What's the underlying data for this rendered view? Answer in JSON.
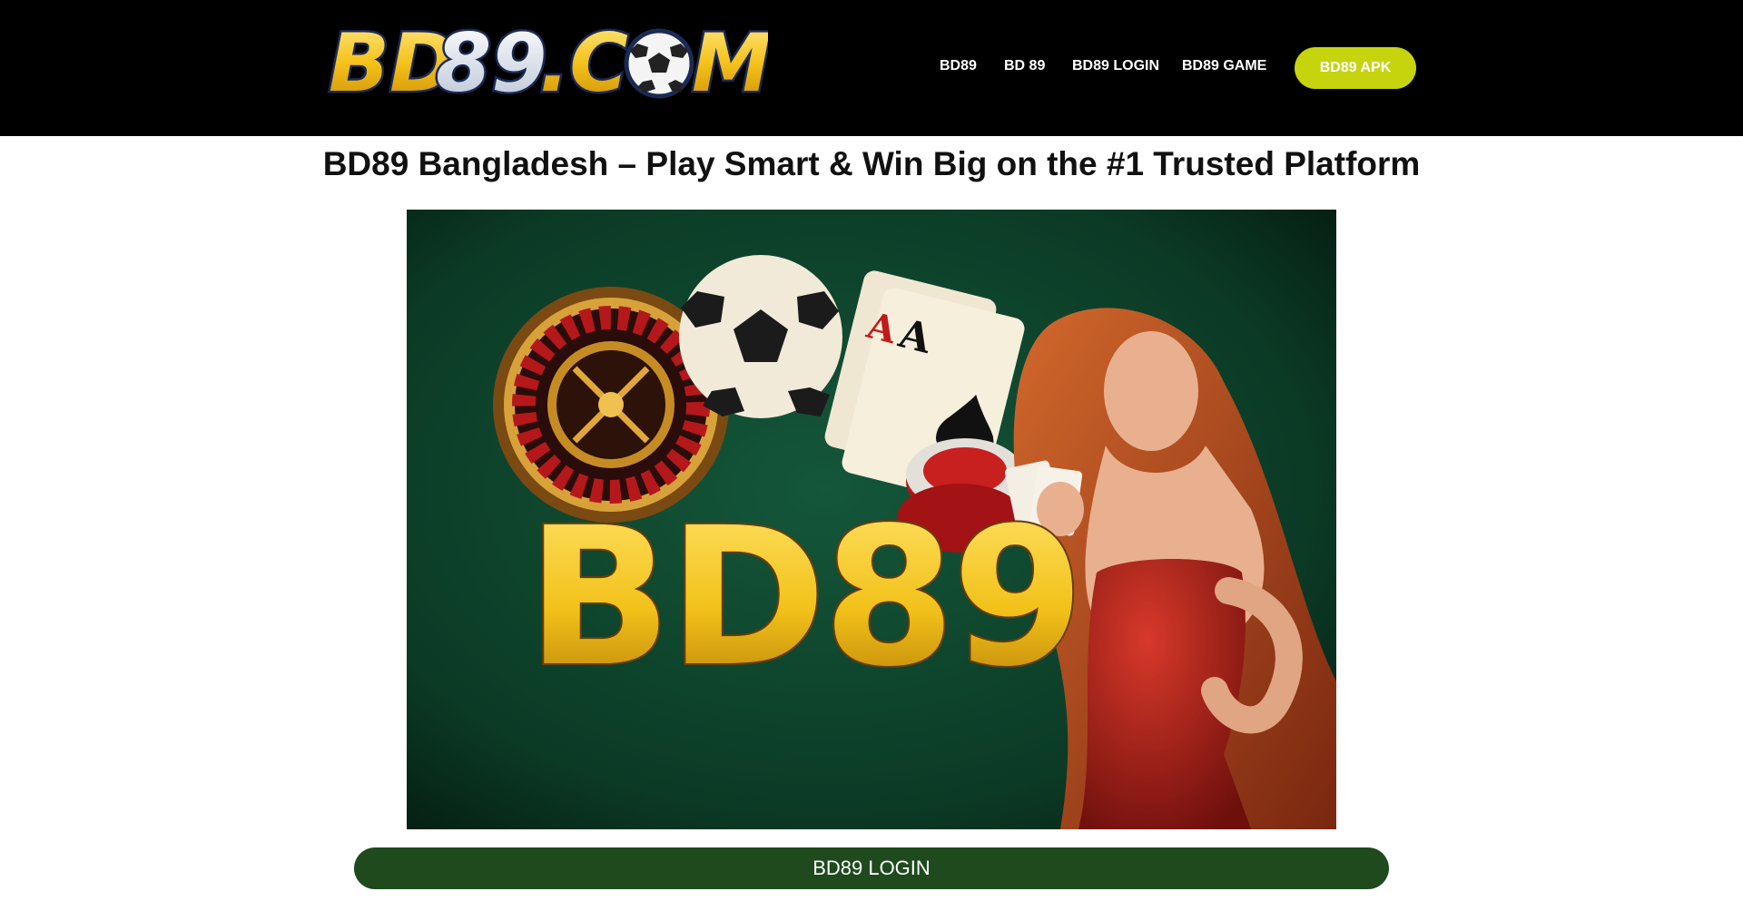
{
  "header": {
    "logo_text": "BD89.COM",
    "nav": [
      {
        "label": "BD89"
      },
      {
        "label": "BD 89"
      },
      {
        "label": "BD89 LOGIN"
      },
      {
        "label": "BD89 GAME"
      }
    ],
    "apk_button": "BD89 APK"
  },
  "main": {
    "title": "BD89 Bangladesh – Play Smart & Win Big on the #1 Trusted Platform",
    "hero_text": "BD89",
    "login_button": "BD89 LOGIN"
  },
  "colors": {
    "header_bg": "#000000",
    "apk_button": "#c6d40e",
    "login_bar": "#1e4a1d",
    "hero_bg": "#0d3a24",
    "gold": "#f2c21a"
  }
}
